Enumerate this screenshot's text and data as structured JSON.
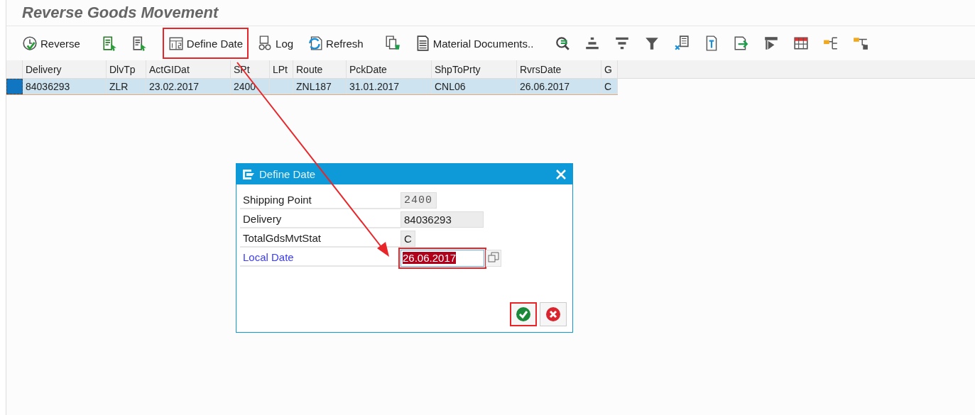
{
  "title": "Reverse Goods Movement",
  "toolbar": [
    {
      "kind": "labeled",
      "label": "Reverse",
      "highlighted": false
    },
    {
      "kind": "icon",
      "highlighted": false
    },
    {
      "kind": "icon",
      "highlighted": false
    },
    {
      "kind": "labeled",
      "label": "Define Date",
      "highlighted": true
    },
    {
      "kind": "labeled",
      "label": "Log",
      "highlighted": false
    },
    {
      "kind": "labeled",
      "label": "Refresh",
      "highlighted": false
    },
    {
      "kind": "icon",
      "highlighted": false
    },
    {
      "kind": "labeled",
      "label": "Material Documents..",
      "highlighted": false
    },
    {
      "kind": "icon",
      "highlighted": false
    },
    {
      "kind": "icon",
      "highlighted": false
    },
    {
      "kind": "icon",
      "highlighted": false
    },
    {
      "kind": "icon",
      "highlighted": false
    },
    {
      "kind": "icon",
      "highlighted": false
    },
    {
      "kind": "icon",
      "highlighted": false
    },
    {
      "kind": "icon",
      "highlighted": false
    },
    {
      "kind": "icon",
      "highlighted": false
    },
    {
      "kind": "icon",
      "highlighted": false
    },
    {
      "kind": "icon",
      "highlighted": false
    },
    {
      "kind": "icon",
      "highlighted": false
    }
  ],
  "table": {
    "columns": [
      "Delivery",
      "DlvTp",
      "ActGIDat",
      "SPt",
      "LPt",
      "Route",
      "PckDate",
      "ShpToPrty",
      "RvrsDate",
      "G"
    ],
    "rows": [
      {
        "selected": true,
        "cells": [
          "84036293",
          "ZLR",
          "23.02.2017",
          "2400",
          "",
          "ZNL187",
          "31.01.2017",
          "CNL06",
          "26.06.2017",
          "C"
        ]
      }
    ]
  },
  "dialog": {
    "title": "Define Date",
    "fields": [
      {
        "kind": "display",
        "label": "Shipping Point",
        "value": "2400"
      },
      {
        "kind": "display",
        "label": "Delivery",
        "value": "84036293"
      },
      {
        "kind": "display",
        "label": "TotalGdsMvtStat",
        "value": "C"
      },
      {
        "kind": "input",
        "label": "Local Date",
        "value": "26.06.2017",
        "selected": true
      }
    ],
    "buttons": [
      {
        "kind": "confirm",
        "highlighted": true
      },
      {
        "kind": "cancel",
        "highlighted": false
      }
    ]
  },
  "annotation": {
    "kind": "arrow"
  }
}
